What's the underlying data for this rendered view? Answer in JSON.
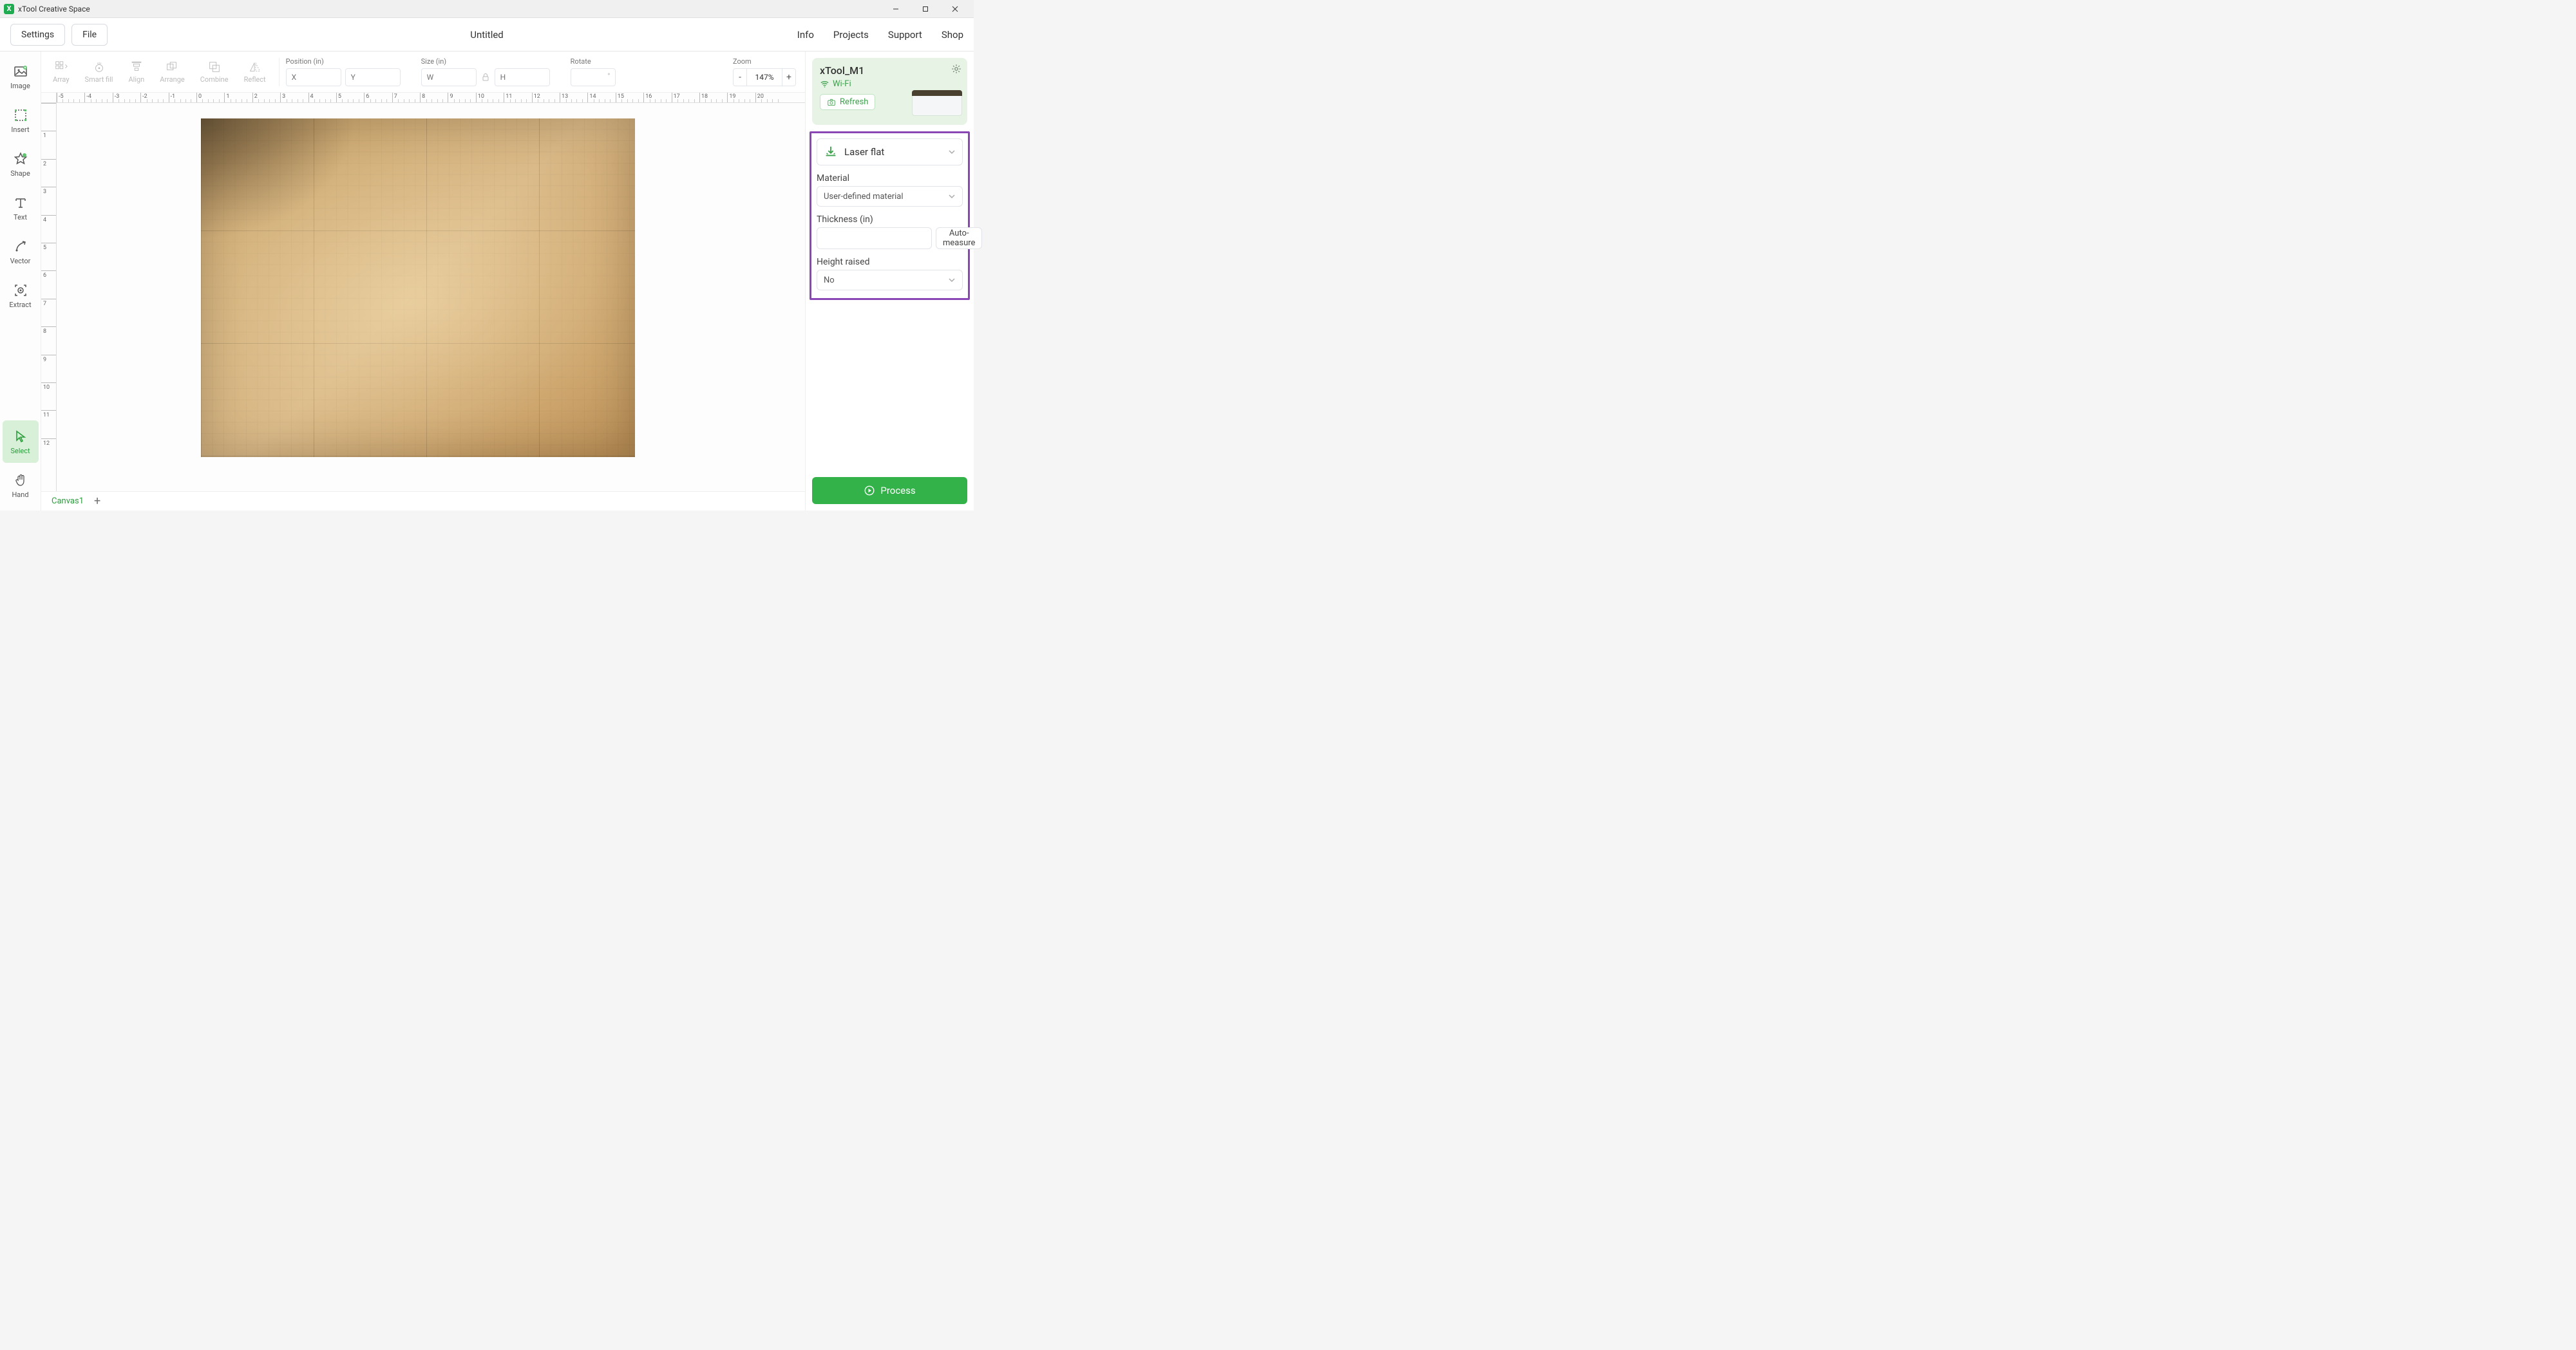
{
  "titlebar": {
    "app_name": "xTool Creative Space",
    "app_icon_letter": "X"
  },
  "menubar": {
    "settings": "Settings",
    "file": "File",
    "doc_title": "Untitled",
    "links": {
      "info": "Info",
      "projects": "Projects",
      "support": "Support",
      "shop": "Shop"
    }
  },
  "left_tools": {
    "image": "Image",
    "insert": "Insert",
    "shape": "Shape",
    "text": "Text",
    "vector": "Vector",
    "extract": "Extract",
    "select": "Select",
    "hand": "Hand"
  },
  "toolbar": {
    "array": "Array",
    "smartfill": "Smart fill",
    "align": "Align",
    "arrange": "Arrange",
    "combine": "Combine",
    "reflect": "Reflect",
    "position_label": "Position (in)",
    "x_ph": "X",
    "y_ph": "Y",
    "size_label": "Size (in)",
    "w_ph": "W",
    "h_ph": "H",
    "rotate_label": "Rotate",
    "rotate_unit": "°",
    "zoom_label": "Zoom",
    "zoom_value": "147%"
  },
  "ruler": {
    "h": [
      "-5",
      "-4",
      "-3",
      "-2",
      "-1",
      "0",
      "1",
      "2",
      "3",
      "4",
      "5",
      "6",
      "7",
      "8",
      "9",
      "10",
      "11",
      "12",
      "13",
      "14",
      "15",
      "16",
      "17",
      "18",
      "19",
      "20"
    ],
    "v": [
      "",
      "1",
      "2",
      "3",
      "4",
      "5",
      "6",
      "7",
      "8",
      "9",
      "10",
      "11",
      "12"
    ]
  },
  "tabs": {
    "canvas1": "Canvas1"
  },
  "right": {
    "device_name": "xTool_M1",
    "wifi_label": "Wi-Fi",
    "refresh": "Refresh",
    "mode_label": "Laser flat",
    "material_label": "Material",
    "material_value": "User-defined material",
    "thickness_label": "Thickness (in)",
    "auto_measure": "Auto-measure",
    "height_label": "Height raised",
    "height_value": "No",
    "process": "Process"
  }
}
